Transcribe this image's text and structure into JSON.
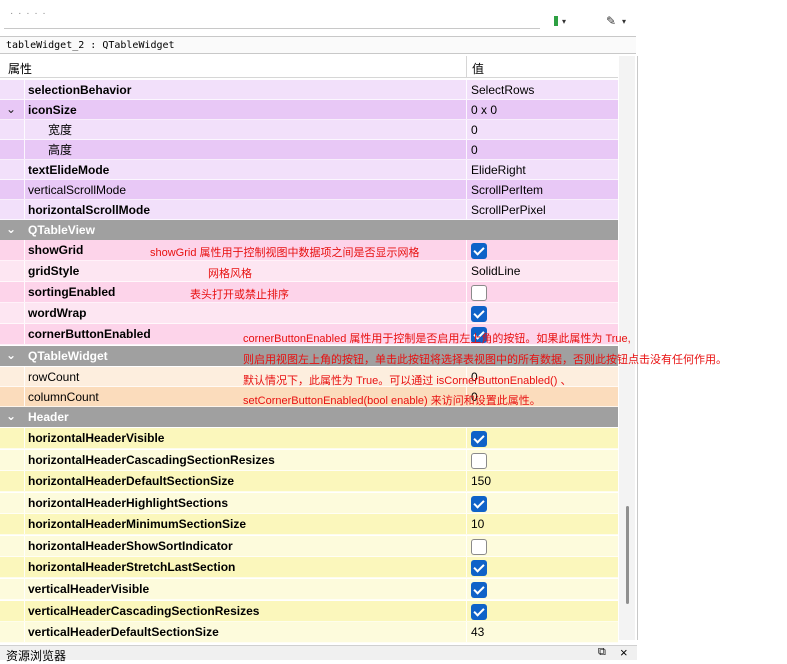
{
  "colors": {
    "purple_dark": "#e8c8f6",
    "purple_light": "#f2e0fa",
    "pink_dark": "#fdd4ea",
    "pink_light": "#fde6f2",
    "peach_dark": "#fbdcbc",
    "peach_light": "#fdeede",
    "yellow_dark": "#fbf7bc",
    "yellow_light": "#fdfbdc",
    "category": "#a0a0a0",
    "annotation": "#e81010",
    "checkbox_on": "#0f62c8"
  },
  "widget_title": "tableWidget_2 : QTableWidget",
  "toolbar": {
    "dots": "· · · · ·"
  },
  "header": {
    "property": "属性",
    "value": "值"
  },
  "rows": [
    {
      "name": "selectionBehavior",
      "value": "SelectRows",
      "bold": true
    },
    {
      "name": "iconSize",
      "value": "0 x 0",
      "bold": true,
      "expander": "v"
    },
    {
      "name": "宽度",
      "value": "0",
      "sub": true
    },
    {
      "name": "高度",
      "value": "0",
      "sub": true
    },
    {
      "name": "textElideMode",
      "value": "ElideRight",
      "bold": true
    },
    {
      "name": "verticalScrollMode",
      "value": "ScrollPerItem",
      "bold": false
    },
    {
      "name": "horizontalScrollMode",
      "value": "ScrollPerPixel",
      "bold": true
    },
    {
      "category": "QTableView",
      "expander": "v"
    },
    {
      "name": "showGrid",
      "checkbox": true,
      "bold": true
    },
    {
      "name": "gridStyle",
      "value": "SolidLine",
      "bold": true
    },
    {
      "name": "sortingEnabled",
      "checkbox": false,
      "bold": true
    },
    {
      "name": "wordWrap",
      "checkbox": true,
      "bold": true
    },
    {
      "name": "cornerButtonEnabled",
      "checkbox": true,
      "bold": true
    },
    {
      "category": "QTableWidget",
      "expander": "v"
    },
    {
      "name": "rowCount",
      "value": "0",
      "bold": false
    },
    {
      "name": "columnCount",
      "value": "0",
      "bold": false
    },
    {
      "category": "Header",
      "expander": "v"
    },
    {
      "name": "horizontalHeaderVisible",
      "checkbox": true,
      "bold": true
    },
    {
      "name": "horizontalHeaderCascadingSectionResizes",
      "checkbox": false,
      "bold": true
    },
    {
      "name": "horizontalHeaderDefaultSectionSize",
      "value": "150",
      "bold": true
    },
    {
      "name": "horizontalHeaderHighlightSections",
      "checkbox": true,
      "bold": true
    },
    {
      "name": "horizontalHeaderMinimumSectionSize",
      "value": "10",
      "bold": true
    },
    {
      "name": "horizontalHeaderShowSortIndicator",
      "checkbox": false,
      "bold": true
    },
    {
      "name": "horizontalHeaderStretchLastSection",
      "checkbox": true,
      "bold": true
    },
    {
      "name": "verticalHeaderVisible",
      "checkbox": true,
      "bold": true
    },
    {
      "name": "verticalHeaderCascadingSectionResizes",
      "checkbox": true,
      "bold": true
    },
    {
      "name": "verticalHeaderDefaultSectionSize",
      "value": "43",
      "bold": true
    }
  ],
  "annotations": {
    "showgrid": "showGrid 属性用于控制视图中数据项之间是否显示网格",
    "gridstyle": "网格风格",
    "sorting": "表头打开或禁止排序",
    "corner1": "cornerButtonEnabled 属性用于控制是否启用左上角的按钮。如果此属性为 True,",
    "corner2": "则启用视图左上角的按钮，单击此按钮将选择表视图中的所有数据，否则此按钮点击没有任何作用。",
    "corner3": "默认情况下，此属性为 True。可以通过 isCornerButtonEnabled() 、",
    "corner4": "setCornerButtonEnabled(bool enable) 来访问和设置此属性。"
  },
  "bottom_dock": {
    "title": "资源浏览器",
    "float_icon": "float-icon",
    "close_icon": "close-icon"
  }
}
